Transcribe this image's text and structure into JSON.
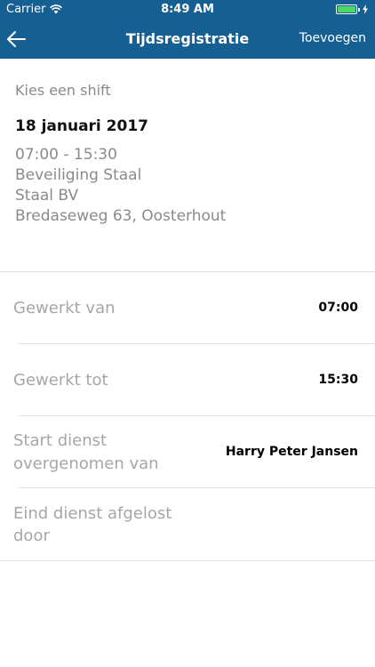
{
  "status_bar": {
    "carrier": "Carrier",
    "time": "8:49 AM"
  },
  "nav": {
    "title": "Tijdsregistratie",
    "action": "Toevoegen",
    "back_icon": "back-arrow-icon"
  },
  "shift": {
    "prompt": "Kies een shift",
    "date": "18 januari 2017",
    "time_range": "07:00 - 15:30",
    "service": "Beveiliging Staal",
    "company": "Staal BV",
    "address": "Bredaseweg 63, Oosterhout"
  },
  "fields": [
    {
      "label": "Gewerkt van",
      "value": "07:00"
    },
    {
      "label": "Gewerkt tot",
      "value": "15:30"
    },
    {
      "label_line1": "Start dienst",
      "label_line2": "overgenomen van",
      "value": "Harry Peter  Jansen"
    },
    {
      "label_line1": "Eind dienst afgelost",
      "label_line2": "door",
      "value": ""
    }
  ],
  "colors": {
    "nav_bg": "#155f92",
    "label_gray": "#a6a6a6",
    "battery_green": "#4cd964"
  }
}
